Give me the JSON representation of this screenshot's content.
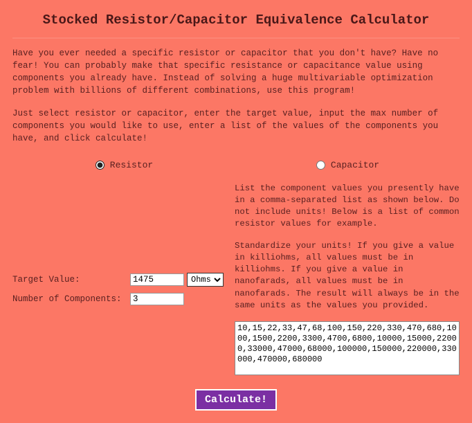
{
  "page": {
    "title": "Stocked Resistor/Capacitor Equivalence Calculator",
    "intro1": "Have you ever needed a specific resistor or capacitor that you don't have? Have no fear! You can probably make that specific resistance or capacitance value using components you already have. Instead of solving a huge multivariable optimization problem with billions of different combinations, use this program!",
    "intro2": "Just select resistor or capacitor, enter the target value, input the max number of components you would like to use, enter a list of the values of the components you have, and click calculate!"
  },
  "radios": {
    "resistor_label": "Resistor",
    "capacitor_label": "Capacitor"
  },
  "form": {
    "target_label": "Target Value:",
    "target_value": "1475",
    "unit_selected": "Ohms",
    "num_label": "Number of Components:",
    "num_value": "3"
  },
  "right": {
    "p1": "List the component values you presently have in a comma-separated list as shown below. Do not include units! Below is a list of common resistor values for example.",
    "p2": "Standardize your units! If you give a value in killiohms, all values must be in killiohms. If you give a value in nanofarads, all values must be in nanofarads. The result will always be in the same units as the values you provided.",
    "values": "10,15,22,33,47,68,100,150,220,330,470,680,1000,1500,2200,3300,4700,6800,10000,15000,22000,33000,47000,68000,100000,150000,220000,330000,470000,680000"
  },
  "button": {
    "label": "Calculate!"
  }
}
